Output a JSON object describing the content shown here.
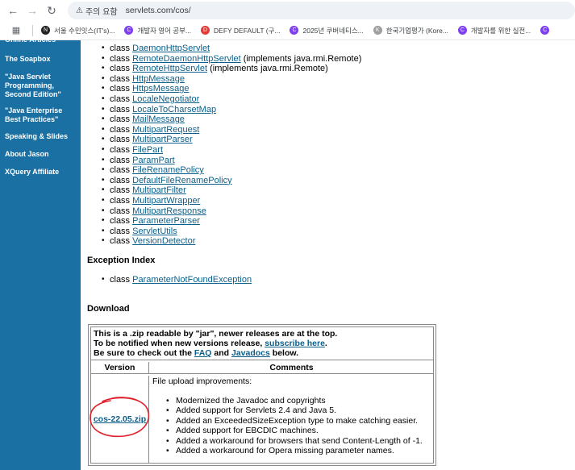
{
  "browser": {
    "security_label": "주의 요함",
    "url": "servlets.com/cos/",
    "bookmarks": [
      {
        "label": "서울 수민잇스(IT's)...",
        "color": "#222222",
        "icon": "N"
      },
      {
        "label": "개발자 영어 공부...",
        "color": "#7e3ff2",
        "icon": "C"
      },
      {
        "label": "DEFY DEFAULT (구...",
        "color": "#e53935",
        "icon": "D"
      },
      {
        "label": "2025년 쿠버네티스...",
        "color": "#7e3ff2",
        "icon": "C"
      },
      {
        "label": "한국기업평가 (Kore...",
        "color": "#9e9e9e",
        "icon": "K"
      },
      {
        "label": "개발자를 위한 실전...",
        "color": "#7e3ff2",
        "icon": "C"
      },
      {
        "label": "",
        "color": "#7e3ff2",
        "icon": "C"
      }
    ]
  },
  "sidebar": {
    "items": [
      {
        "label": "Online Articles"
      },
      {
        "label": "The Soapbox"
      },
      {
        "label": "\"Java Servlet Programming, Second Edition\""
      },
      {
        "label": "\"Java Enterprise Best Practices\""
      },
      {
        "label": "Speaking & Slides"
      },
      {
        "label": "About Jason"
      },
      {
        "label": "XQuery Affiliate"
      }
    ]
  },
  "classes": {
    "prefix": "class",
    "items": [
      {
        "name": "DaemonHttpServlet",
        "suffix": ""
      },
      {
        "name": "RemoteDaemonHttpServlet",
        "suffix": " (implements java.rmi.Remote)"
      },
      {
        "name": "RemoteHttpServlet",
        "suffix": " (implements java.rmi.Remote)"
      },
      {
        "name": "HttpMessage",
        "suffix": ""
      },
      {
        "name": "HttpsMessage",
        "suffix": ""
      },
      {
        "name": "LocaleNegotiator",
        "suffix": ""
      },
      {
        "name": "LocaleToCharsetMap",
        "suffix": ""
      },
      {
        "name": "MailMessage",
        "suffix": ""
      },
      {
        "name": "MultipartRequest",
        "suffix": ""
      },
      {
        "name": "MultipartParser",
        "suffix": ""
      },
      {
        "name": "FilePart",
        "suffix": ""
      },
      {
        "name": "ParamPart",
        "suffix": ""
      },
      {
        "name": "FileRenamePolicy",
        "suffix": ""
      },
      {
        "name": "DefaultFileRenamePolicy",
        "suffix": ""
      },
      {
        "name": "MultipartFilter",
        "suffix": ""
      },
      {
        "name": "MultipartWrapper",
        "suffix": ""
      },
      {
        "name": "MultipartResponse",
        "suffix": ""
      },
      {
        "name": "ParameterParser",
        "suffix": ""
      },
      {
        "name": "ServletUtils",
        "suffix": ""
      },
      {
        "name": "VersionDetector",
        "suffix": ""
      }
    ]
  },
  "exception_index": {
    "title": "Exception Index",
    "prefix": "class",
    "item": "ParameterNotFoundException"
  },
  "download": {
    "title": "Download",
    "intro_line1": "This is a .zip readable by \"jar\", newer releases are at the top.",
    "intro_line2_pre": "To be notified when new versions release, ",
    "intro_line2_link": "subscribe here",
    "intro_line2_post": ".",
    "intro_line3_pre": "Be sure to check out the ",
    "faq_link": "FAQ",
    "intro_line3_mid": " and ",
    "javadocs_link": "Javadocs",
    "intro_line3_post": " below.",
    "col_version": "Version",
    "col_comments": "Comments",
    "version_file": "cos-22.05.zip",
    "comment_heading": "File upload improvements:",
    "changes": [
      "Modernized the Javadoc and copyrights",
      "Added support for Servlets 2.4 and Java 5.",
      "Added an ExceededSizeException type to make catching easier.",
      "Added support for EBCDIC machines.",
      "Added a workaround for browsers that send Content-Length of -1.",
      "Added a workaround for Opera missing parameter names."
    ]
  },
  "colors": {
    "sidebar": "#1a6fa3",
    "link": "#0b5f8a",
    "annotation": "#e0202a"
  }
}
